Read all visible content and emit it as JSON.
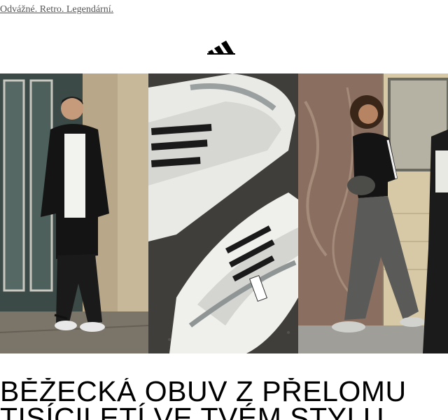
{
  "preheader": {
    "text": "Odvážné. Retro. Legendární."
  },
  "brand": {
    "logo_icon": "adidas-logo-icon",
    "color": "#000000"
  },
  "hero": {
    "panels": [
      {
        "name": "hero-photo-man-tracksuit",
        "description_icon": "photo"
      },
      {
        "name": "hero-photo-sneakers-closeup",
        "description_icon": "photo"
      },
      {
        "name": "hero-photo-woman-walking",
        "description_icon": "photo"
      }
    ]
  },
  "headline": {
    "line1": "BĚŽECKÁ OBUV Z PŘELOMU",
    "line2": "TISÍCILETÍ VE TVÉM STYLU"
  }
}
